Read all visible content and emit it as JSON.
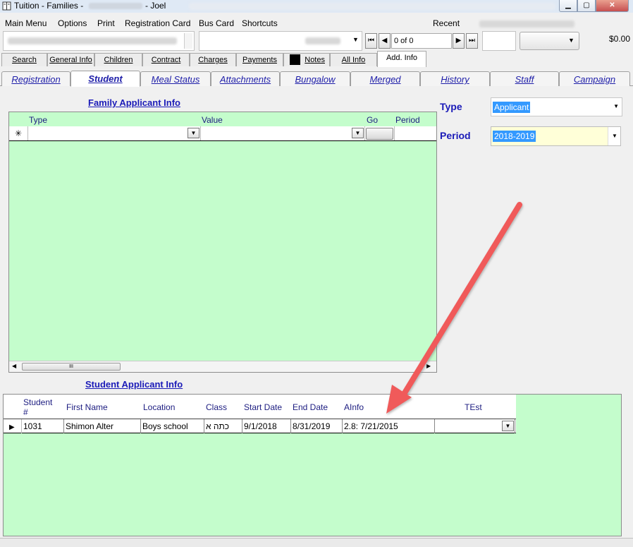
{
  "window": {
    "title_prefix": "Tuition - Families -",
    "title_suffix": "- Joel",
    "minimize_icon": "minimize-icon",
    "maximize_icon": "maximize-icon",
    "close_icon": "close-icon"
  },
  "menu": [
    "Main Menu",
    "Options",
    "Print",
    "Registration Card",
    "Bus Card",
    "Shortcuts"
  ],
  "recent_label": "Recent",
  "toolbar": {
    "record_nav": "0 of 0",
    "amount": "$0.00"
  },
  "top_tabs": [
    "Search",
    "General Info",
    "Children",
    "Contract",
    "Charges",
    "Payments",
    "Notes",
    "All Info",
    "Add. Info"
  ],
  "sub_tabs": [
    "Registration",
    "Student",
    "Meal Status",
    "Attachments",
    "Bungalow",
    "Merged",
    "History",
    "Staff",
    "Campaign"
  ],
  "family_applicant": {
    "title": "Family Applicant Info",
    "columns": [
      "Type",
      "Value",
      "Go",
      "Period"
    ],
    "new_row_marker": "✳",
    "scroll_thumb": "III"
  },
  "filters": {
    "type_label": "Type",
    "type_value": "Applicant",
    "period_label": "Period",
    "period_value": "2018-2019"
  },
  "student_applicant": {
    "title": "Student Applicant Info",
    "columns": [
      "Student #",
      "First Name",
      "Location",
      "Class",
      "Start Date",
      "End Date",
      "AInfo",
      "TEst"
    ],
    "rows": [
      {
        "student_no": "1031",
        "first_name": "Shimon Alter",
        "location": "Boys school",
        "class": "כתה א",
        "start_date": "9/1/2018",
        "end_date": "8/31/2019",
        "ainfo": "2.8: 7/21/2015",
        "test": ""
      }
    ]
  },
  "colors": {
    "grid_bg": "#c4fdcc",
    "label_blue": "#1b1bb8",
    "annotation_arrow": "#f05a5a",
    "selection": "#3399ff"
  }
}
